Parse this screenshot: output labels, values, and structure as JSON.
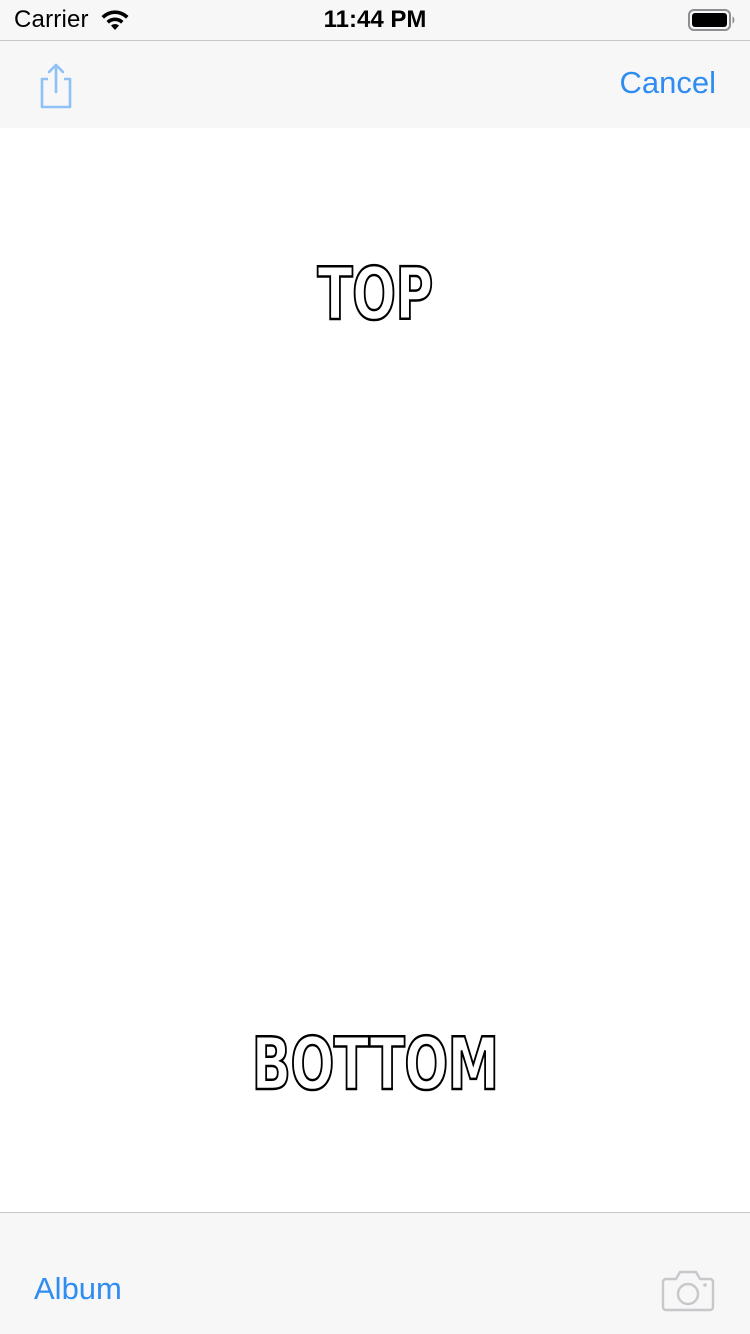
{
  "status_bar": {
    "carrier": "Carrier",
    "time": "11:44 PM",
    "wifi_icon": "wifi-icon",
    "battery_icon": "battery-icon"
  },
  "nav_bar": {
    "share_icon": "share-icon",
    "cancel_label": "Cancel"
  },
  "meme": {
    "top_text": "TOP",
    "bottom_text": "BOTTOM"
  },
  "toolbar": {
    "album_label": "Album",
    "camera_icon": "camera-icon"
  },
  "colors": {
    "accent": "#2f8cf0",
    "bar_background": "#f7f7f7",
    "disabled_icon": "#c7c7cc",
    "share_icon_tint": "#8fc1f7"
  }
}
